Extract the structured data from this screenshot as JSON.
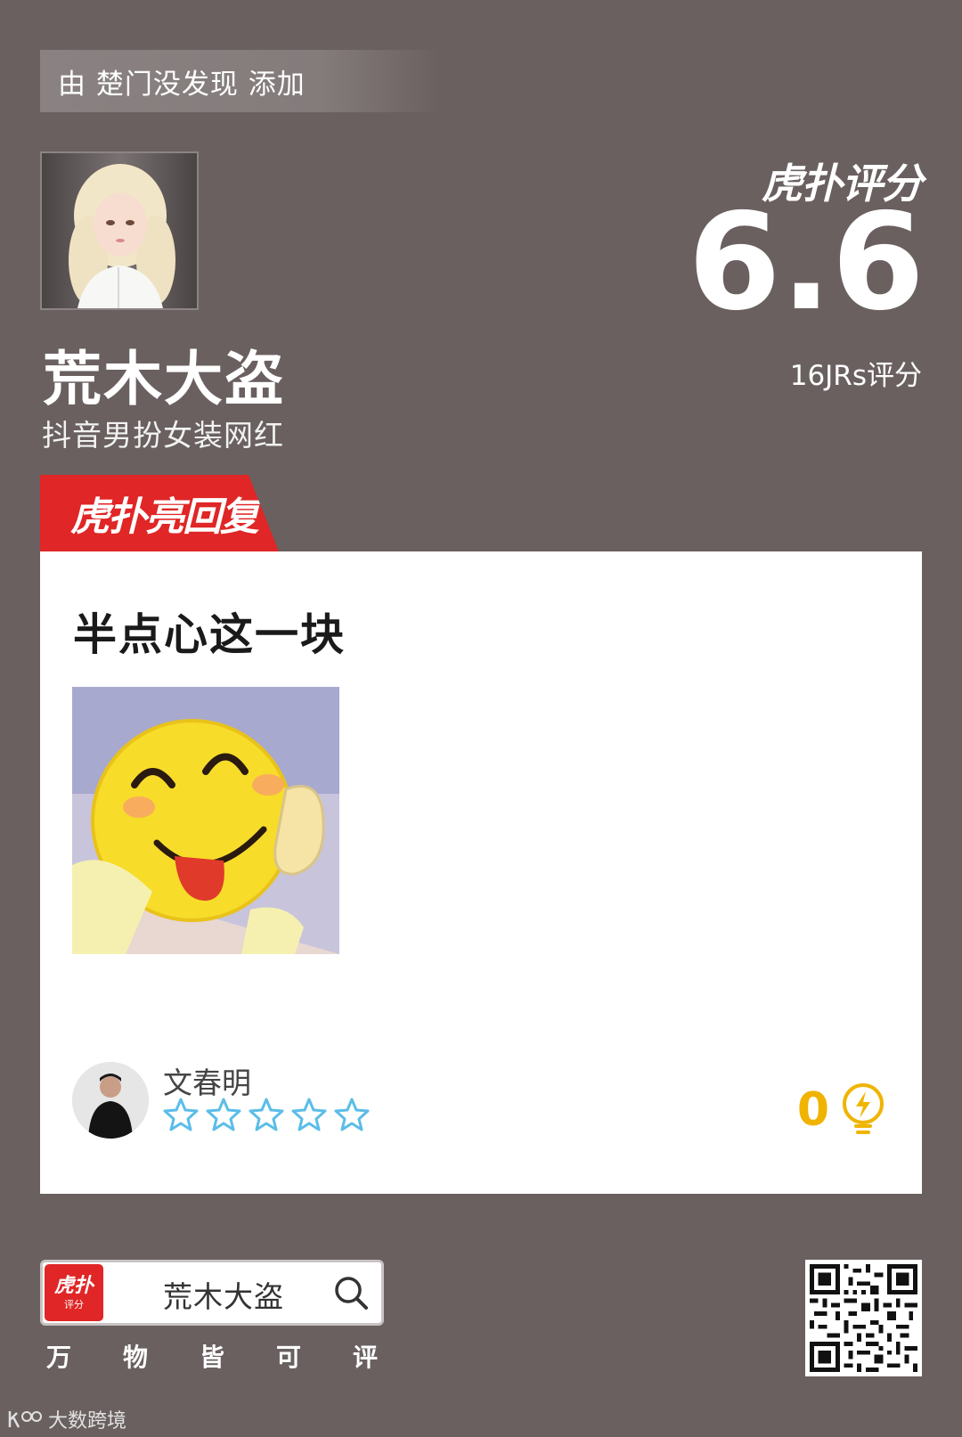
{
  "added_by": "由 楚门没发现 添加",
  "subject": {
    "name": "荒木大盗",
    "description": "抖音男扮女装网红"
  },
  "score": {
    "brand": "虎扑评分",
    "value": "6.6",
    "count_label": "16JRs评分"
  },
  "highlight": {
    "tab_label": "虎扑亮回复",
    "comment_text": "半点心这一块",
    "user_name": "文春明",
    "stars": 0,
    "likes": "0"
  },
  "footer": {
    "logo_main": "虎扑",
    "logo_sub": "评分",
    "search_text": "荒木大盗",
    "slogan": [
      "万",
      "物",
      "皆",
      "可",
      "评"
    ]
  },
  "watermark": "大数跨境",
  "colors": {
    "background": "#6a6060",
    "accent_red": "#e02626",
    "star_blue": "#5bbde8",
    "like_yellow": "#f0b400"
  }
}
